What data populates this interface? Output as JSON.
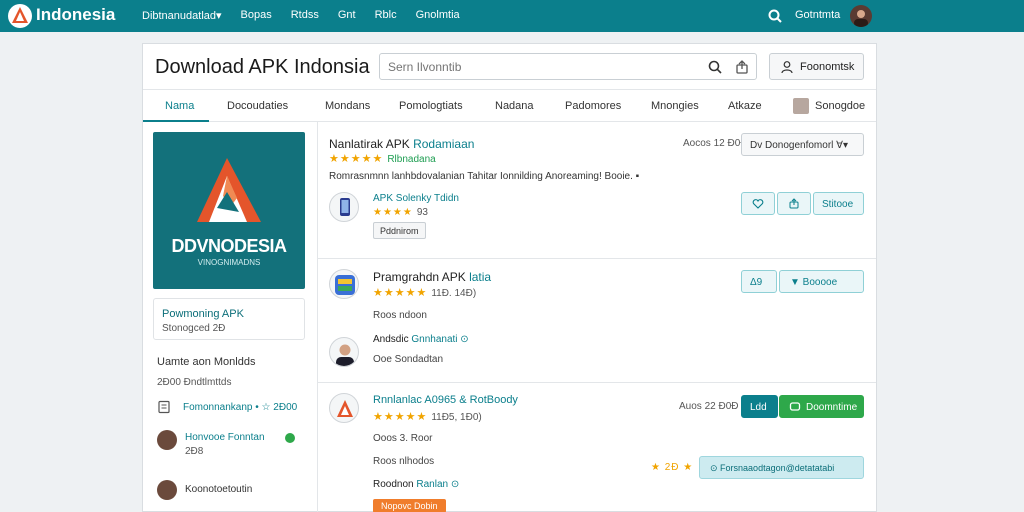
{
  "topbar": {
    "brand": "Indonesia",
    "nav": [
      "Dibtnanudatlad▾",
      "Bopas",
      "Rtdss",
      "Gnt",
      "Rblc",
      "Gnolmtia"
    ],
    "user": "Gotntmta"
  },
  "header": {
    "title": "Download APK Indonsia",
    "search_placeholder": "Sern Ilvonntib",
    "follow_label": "Foonomtsk"
  },
  "tabs": [
    "Nama",
    "Docoudaties",
    "Mondans",
    "Pomologtiats",
    "Nadana",
    "Padomores",
    "Mnongies",
    "Atkaze",
    "Sonogdoe"
  ],
  "sidebar": {
    "hero_title": "DDVNODESIA",
    "hero_sub": "VINOGNIMADNS",
    "info_title": "Powmoning APK",
    "info_sub": "Stonogced 2Ð",
    "section_title": "Uamte aon Monldds",
    "section_sub": "2Ð00 Ðndtlmttds",
    "link_text": "Fomonnankanp • ☆ 2Ð00",
    "person1_name": "Honvooe Fonntan",
    "person1_meta": "2Ð8",
    "person2_name": "Koonotoetoutin"
  },
  "listing": {
    "app1": {
      "name": "Nanlatirak APK",
      "accent": "Rodamiaan",
      "rating_meta": "Rlbnadana",
      "size": "Aocos 12 Ð0Ð",
      "select_label": "Dv Donogenfomorl ∀▾",
      "desc": "Romrasnmnn lanhbdovalanian Tahitar Ionnilding Anoreaming! Booie. ▪",
      "sub_name": "APK Solenky Tdidn",
      "sub_rating": "93",
      "tag": "Pddnirom",
      "btn3": "Stitooe"
    },
    "app2": {
      "name": "Pramgrahdn APK",
      "accent": "latia",
      "rating_meta": "11Ð. 14Ð)",
      "btn_a": "Δ9",
      "btn_b": "▼ Booooe",
      "line1": "Roos ndoon",
      "person_name": "Andsdic",
      "person_accent": "Gnnhanati ⊙",
      "line2": "Ooe Sondadtan"
    },
    "app3": {
      "name": "Rnnlanlac A0965 & RotBoody",
      "rating_meta": "11Ð5, 1Ð0)",
      "size": "Auos 22 Ð0Ð",
      "btn_teal": "Ldd",
      "btn_green": "Doomntime",
      "line1": "Ooos 3. Roor",
      "line2": "Roos nlhodos",
      "stars_mini": "★ 2Ð ★",
      "btn_light": "⊙ Forsnaaodtagon@detatatabi",
      "line3": "Roodnon",
      "line3_accent": "Ranlan ⊙",
      "orange": "Nopovc Dobin"
    }
  },
  "colors": {
    "brand": "#0b7f8c",
    "star": "#f1a400",
    "green": "#2ea84a",
    "orange": "#f07d2c"
  }
}
